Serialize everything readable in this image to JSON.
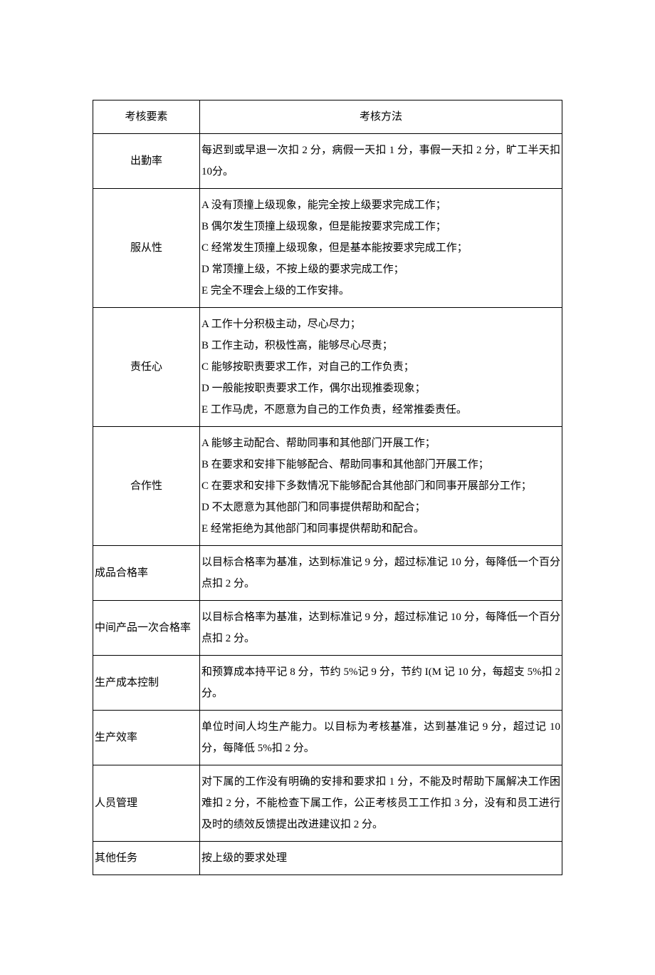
{
  "header": {
    "element": "考核要素",
    "method": "考核方法"
  },
  "rows": [
    {
      "element": "出勤率",
      "method": "每迟到或早退一次扣 2 分，病假一天扣 1 分，事假一天扣 2 分，旷工半天扣 10分。",
      "elementAlign": "center"
    },
    {
      "element": "服从性",
      "method": "A 没有顶撞上级现象，能完全按上级要求完成工作；\nB 偶尔发生顶撞上级现象，但是能按要求完成工作；\nC 经常发生顶撞上级现象，但是基本能按要求完成工作；\nD 常顶撞上级，不按上级的要求完成工作；\nE 完全不理会上级的工作安排。",
      "elementAlign": "center"
    },
    {
      "element": "责任心",
      "method": "A 工作十分积极主动，尽心尽力；\nB 工作主动，积极性高，能够尽心尽责；\nC 能够按职责要求工作，对自己的工作负责；\nD 一般能按职责要求工作，偶尔出现推委现象；\nE 工作马虎，不愿意为自己的工作负责，经常推委责任。",
      "elementAlign": "center"
    },
    {
      "element": "合作性",
      "method": "A 能够主动配合、帮助同事和其他部门开展工作；\nB 在要求和安排下能够配合、帮助同事和其他部门开展工作；\nC 在要求和安排下多数情况下能够配合其他部门和同事开展部分工作；\nD 不太愿意为其他部门和同事提供帮助和配合；\nE 经常拒绝为其他部门和同事提供帮助和配合。",
      "elementAlign": "center"
    },
    {
      "element": "成品合格率",
      "method": "以目标合格率为基准，达到标准记 9 分，超过标准记 10 分，每降低一个百分点扣 2 分。",
      "elementAlign": "left"
    },
    {
      "element": "中间产品一次合格率",
      "method": "以目标合格率为基准，达到标准记 9 分，超过标准记 10 分，每降低一个百分点扣 2 分。",
      "elementAlign": "left"
    },
    {
      "element": "生产成本控制",
      "method": "和预算成本持平记 8 分，节约 5%记 9 分，节约 I(M 记 10 分，每超支 5%扣 2分。",
      "elementAlign": "left"
    },
    {
      "element": "生产效率",
      "method": "单位时间人均生产能力。以目标为考核基准，达到基准记 9 分，超过记 10 分，每降低 5%扣 2 分。",
      "elementAlign": "left"
    },
    {
      "element": "人员管理",
      "method": "对下属的工作没有明确的安排和要求扣 1 分，不能及时帮助下属解决工作困难扣 2 分，不能检查下属工作，公正考核员工工作扣 3 分，没有和员工进行及时的绩效反馈提出改进建议扣 2 分。",
      "elementAlign": "left"
    },
    {
      "element": "其他任务",
      "method": "按上级的要求处理",
      "elementAlign": "left"
    }
  ]
}
